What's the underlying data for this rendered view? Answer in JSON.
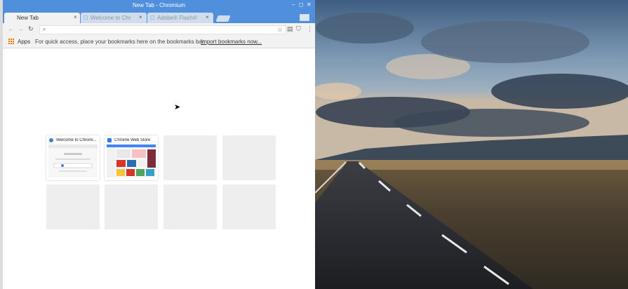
{
  "window": {
    "title": "New Tab - Chromium",
    "controls": [
      "–",
      "◻",
      "✕"
    ]
  },
  "tabs": [
    {
      "label": "New Tab",
      "active": true,
      "close": "×"
    },
    {
      "label": "Welcome to Chron",
      "active": false,
      "close": "×"
    },
    {
      "label": "Adobe® Flash® P",
      "active": false,
      "close": "×"
    }
  ],
  "toolbar": {
    "back_icon": "arrow-left-icon",
    "forward_icon": "arrow-right-icon",
    "reload_icon": "reload-icon",
    "omnibox_value": "",
    "star_icon": "star-icon"
  },
  "bookmarks_bar": {
    "apps_label": "Apps",
    "hint": "For quick access, place your bookmarks here on the bookmarks bar.",
    "import_link": "Import bookmarks now..."
  },
  "most_visited": [
    {
      "title": "Welcome to Chromi...",
      "favicon_color": "#4a7bd9"
    },
    {
      "title": "Chrome Web Store",
      "favicon_color": "#3b78e7"
    },
    {
      "title": ""
    },
    {
      "title": ""
    },
    {
      "title": ""
    },
    {
      "title": ""
    },
    {
      "title": ""
    },
    {
      "title": ""
    }
  ],
  "colors": {
    "titlebar": "#4f8fdc",
    "toolbar": "#f2f2f2"
  }
}
